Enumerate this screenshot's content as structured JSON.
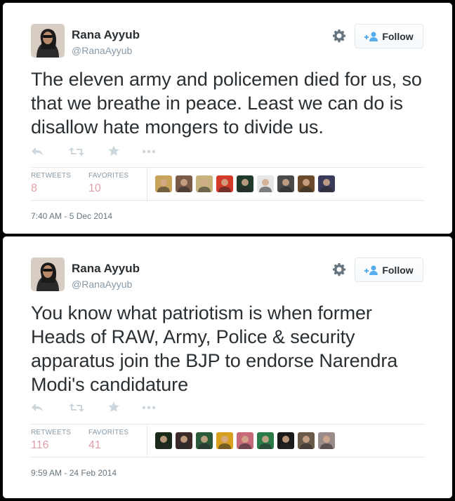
{
  "tweets": [
    {
      "author_name": "Rana Ayyub",
      "author_handle": "@RanaAyyub",
      "follow_label": "Follow",
      "text": "The eleven army and policemen died for us, so that we breathe in peace. Least we can do is disallow hate mongers to divide us.",
      "retweets_label": "RETWEETS",
      "retweets_count": "8",
      "favorites_label": "FAVORITES",
      "favorites_count": "10",
      "timestamp": "7:40 AM - 5 Dec 2014",
      "favoriter_colors": [
        "#c9a35a",
        "#7a5a48",
        "#c6b27a",
        "#d23a2a",
        "#1f3a2a",
        "#e6e6e6",
        "#4a4a4a",
        "#6a4a2a",
        "#3a3a5a"
      ]
    },
    {
      "author_name": "Rana Ayyub",
      "author_handle": "@RanaAyyub",
      "follow_label": "Follow",
      "text": "You know what patriotism is when former Heads of RAW, Army, Police & security apparatus join the BJP to endorse Narendra Modi's candidature",
      "retweets_label": "RETWEETS",
      "retweets_count": "116",
      "favorites_label": "FAVORITES",
      "favorites_count": "41",
      "timestamp": "9:59 AM - 24 Feb 2014",
      "favoriter_colors": [
        "#1a2a1a",
        "#3a2a2a",
        "#2a5a3a",
        "#d9a020",
        "#c66a7a",
        "#2a7a4a",
        "#1a1a1a",
        "#6a5a4a",
        "#9a8a8a"
      ]
    }
  ]
}
